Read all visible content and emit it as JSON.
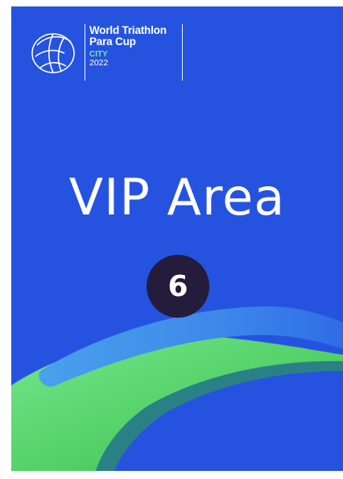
{
  "logo": {
    "title_line1": "World Triathlon",
    "title_line2": "Para Cup",
    "city": "CITY",
    "year": "2022"
  },
  "area": {
    "title": "VIP Area",
    "number": "6"
  },
  "colors": {
    "background": "#2553e0",
    "badge": "#231c3a",
    "accent_green": "#7de2a9",
    "wave_light_blue": "#3e8fe8",
    "wave_green": "#5ed67a"
  }
}
